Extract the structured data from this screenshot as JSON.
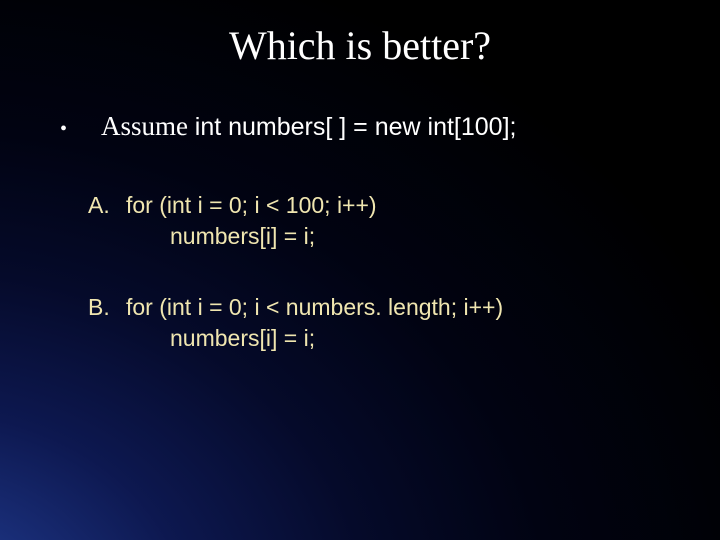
{
  "slide": {
    "title": "Which is better?",
    "bullet": "•",
    "assume_prefix": "Assume ",
    "assume_code": "int numbers[ ] = new int[100];",
    "options": [
      {
        "label": "A.",
        "line1": "for (int i = 0; i < 100; i++)",
        "line2": "numbers[i] = i;"
      },
      {
        "label": "B.",
        "line1": "for (int i = 0; i < numbers. length; i++)",
        "line2": "numbers[i] = i;"
      }
    ]
  }
}
